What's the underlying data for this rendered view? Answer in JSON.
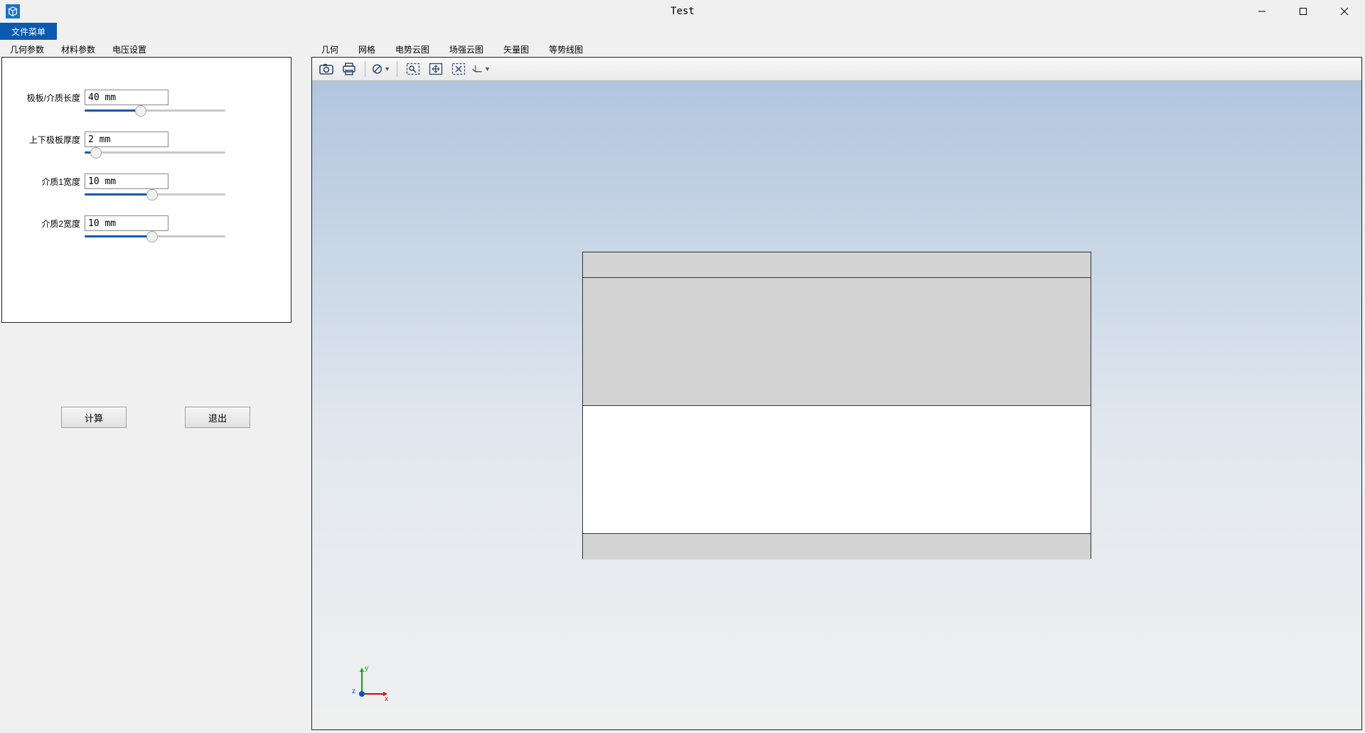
{
  "window": {
    "title": "Test"
  },
  "menubar": {
    "file_menu": "文件菜单"
  },
  "left_tabs": [
    "几何参数",
    "材料参数",
    "电压设置"
  ],
  "params": [
    {
      "label": "极板/介质长度",
      "value": "40 mm",
      "slider_pct": 40
    },
    {
      "label": "上下极板厚度",
      "value": "2 mm",
      "slider_pct": 8
    },
    {
      "label": "介质1宽度",
      "value": "10 mm",
      "slider_pct": 48
    },
    {
      "label": "介质2宽度",
      "value": "10 mm",
      "slider_pct": 48
    }
  ],
  "buttons": {
    "compute": "计算",
    "exit": "退出"
  },
  "right_tabs": [
    "几何",
    "网格",
    "电势云图",
    "场强云图",
    "矢量图",
    "等势线图"
  ],
  "axes": {
    "x": "x",
    "y": "y",
    "z": "z"
  }
}
